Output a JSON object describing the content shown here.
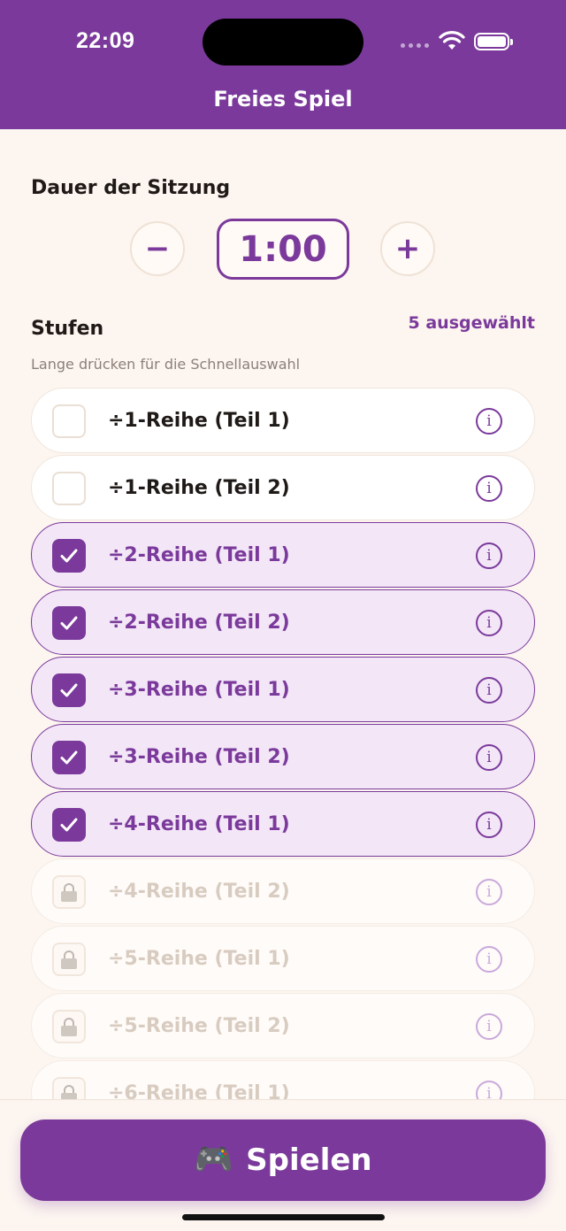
{
  "status_bar": {
    "time": "22:09"
  },
  "header": {
    "title": "Freies Spiel"
  },
  "session": {
    "label": "Dauer der Sitzung",
    "minus_label": "−",
    "plus_label": "+",
    "duration": "1:00"
  },
  "levels": {
    "label": "Stufen",
    "selected_count": "5 ausgewählt",
    "hint": "Lange drücken für die Schnellauswahl",
    "items": [
      {
        "label": "÷1-Reihe (Teil 1)",
        "state": "unchecked"
      },
      {
        "label": "÷1-Reihe (Teil 2)",
        "state": "unchecked"
      },
      {
        "label": "÷2-Reihe (Teil 1)",
        "state": "checked"
      },
      {
        "label": "÷2-Reihe (Teil 2)",
        "state": "checked"
      },
      {
        "label": "÷3-Reihe (Teil 1)",
        "state": "checked"
      },
      {
        "label": "÷3-Reihe (Teil 2)",
        "state": "checked"
      },
      {
        "label": "÷4-Reihe (Teil 1)",
        "state": "checked"
      },
      {
        "label": "÷4-Reihe (Teil 2)",
        "state": "locked"
      },
      {
        "label": "÷5-Reihe (Teil 1)",
        "state": "locked"
      },
      {
        "label": "÷5-Reihe (Teil 2)",
        "state": "locked"
      },
      {
        "label": "÷6-Reihe (Teil 1)",
        "state": "locked"
      }
    ],
    "info_glyph": "i",
    "check_glyph": "✓"
  },
  "footer": {
    "play_label": "Spielen",
    "play_icon": "🎮"
  },
  "colors": {
    "accent": "#7b3a9b",
    "background": "#fcf5f0",
    "selected_row": "#f2e6f7"
  }
}
